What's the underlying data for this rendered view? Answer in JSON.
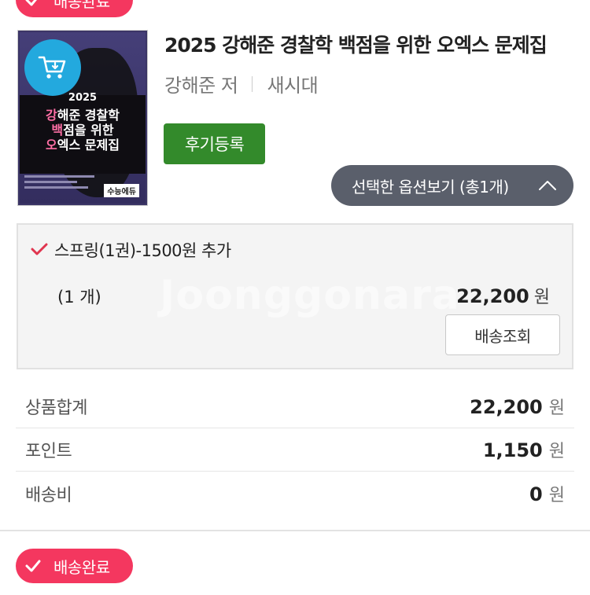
{
  "top_badge": {
    "label": "배송완료"
  },
  "product": {
    "title": "2025 강해준 경찰학 백점을 위한 오엑스 문제집",
    "author": "강해준 저",
    "publisher": "새시대",
    "cover": {
      "year": "2025",
      "line1_accent": "강",
      "line1_rest": "해준 경찰학",
      "line2_accent": "백",
      "line2_rest": "점을 위한",
      "line3_accent": "오",
      "line3_rest": "엑스 문제집",
      "publisher_logo": "수능에듀"
    }
  },
  "buttons": {
    "review": "후기등록",
    "option_toggle": "선택한 옵션보기 (총1개)",
    "shipping_lookup": "배송조회"
  },
  "option": {
    "name": "스프링(1권)-1500원 추가",
    "quantity": "(1 개)",
    "price": "22,200",
    "unit": "원",
    "watermark": "Joonggonara"
  },
  "summary": {
    "rows": [
      {
        "label": "상품합계",
        "value": "22,200",
        "unit": "원"
      },
      {
        "label": "포인트",
        "value": "1,150",
        "unit": "원"
      },
      {
        "label": "배송비",
        "value": "0",
        "unit": "원"
      }
    ]
  },
  "bottom_badge": {
    "label": "배송완료"
  },
  "icons": {
    "badge_check": "check-icon",
    "cart": "cart-icon",
    "chevron": "chevron-up-icon",
    "option_check": "check-icon"
  },
  "colors": {
    "badge": "#f4375f",
    "review_button": "#338a2b",
    "option_toggle": "#5a5f6b",
    "cart_circle": "#23a9de",
    "option_check": "#e0354f"
  }
}
